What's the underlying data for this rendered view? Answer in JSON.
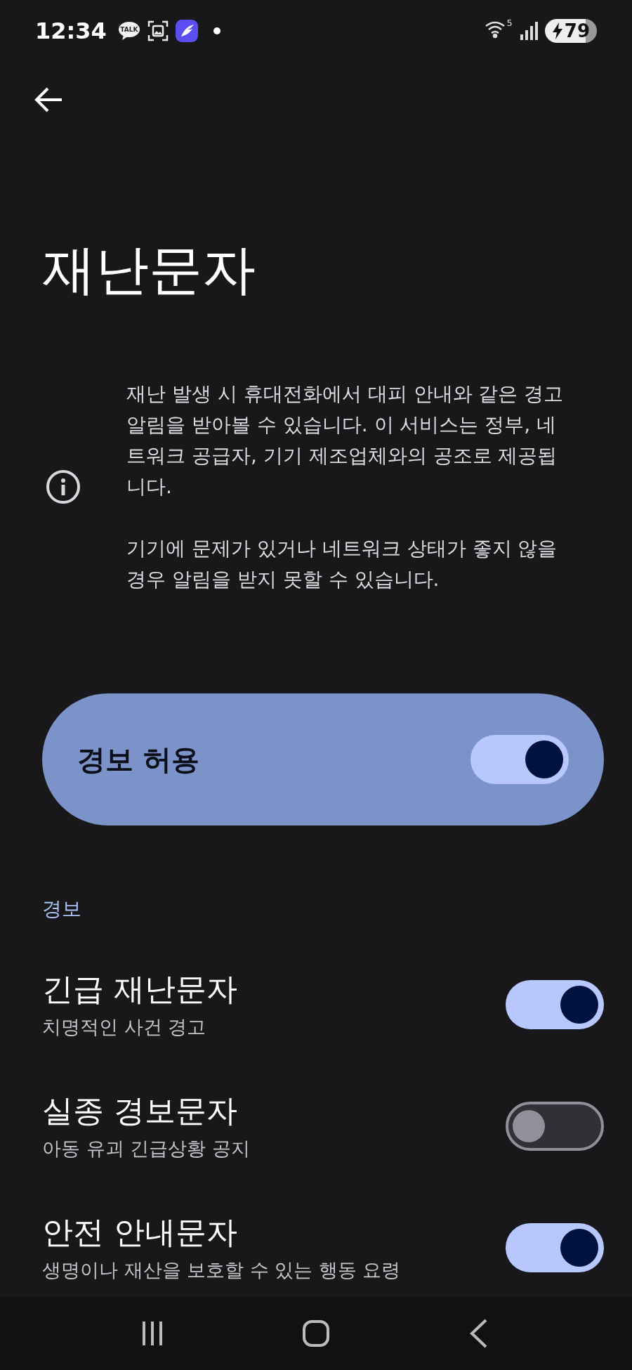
{
  "status_bar": {
    "time": "12:34",
    "talk_badge": "TALK",
    "wifi_band": "5",
    "battery": "79"
  },
  "title": "재난문자",
  "info": {
    "paragraphs": [
      "재난 발생 시 휴대전화에서 대피 안내와 같은 경고 알림을 받아볼 수 있습니다. 이 서비스는 정부, 네트워크 공급자, 기기 제조업체와의 공조로 제공됩니다.",
      "기기에 문제가 있거나 네트워크 상태가 좋지 않을 경우 알림을 받지 못할 수 있습니다."
    ]
  },
  "master_switch": {
    "label": "경보 허용",
    "on": true
  },
  "section": {
    "header": "경보",
    "items": [
      {
        "title": "긴급 재난문자",
        "subtitle": "치명적인 사건 경고",
        "on": true
      },
      {
        "title": "실종 경보문자",
        "subtitle": "아동 유괴 긴급상황 공지",
        "on": false
      },
      {
        "title": "안전 안내문자",
        "subtitle": "생명이나 재산을 보호할 수 있는 행동 요령",
        "on": true
      }
    ]
  }
}
